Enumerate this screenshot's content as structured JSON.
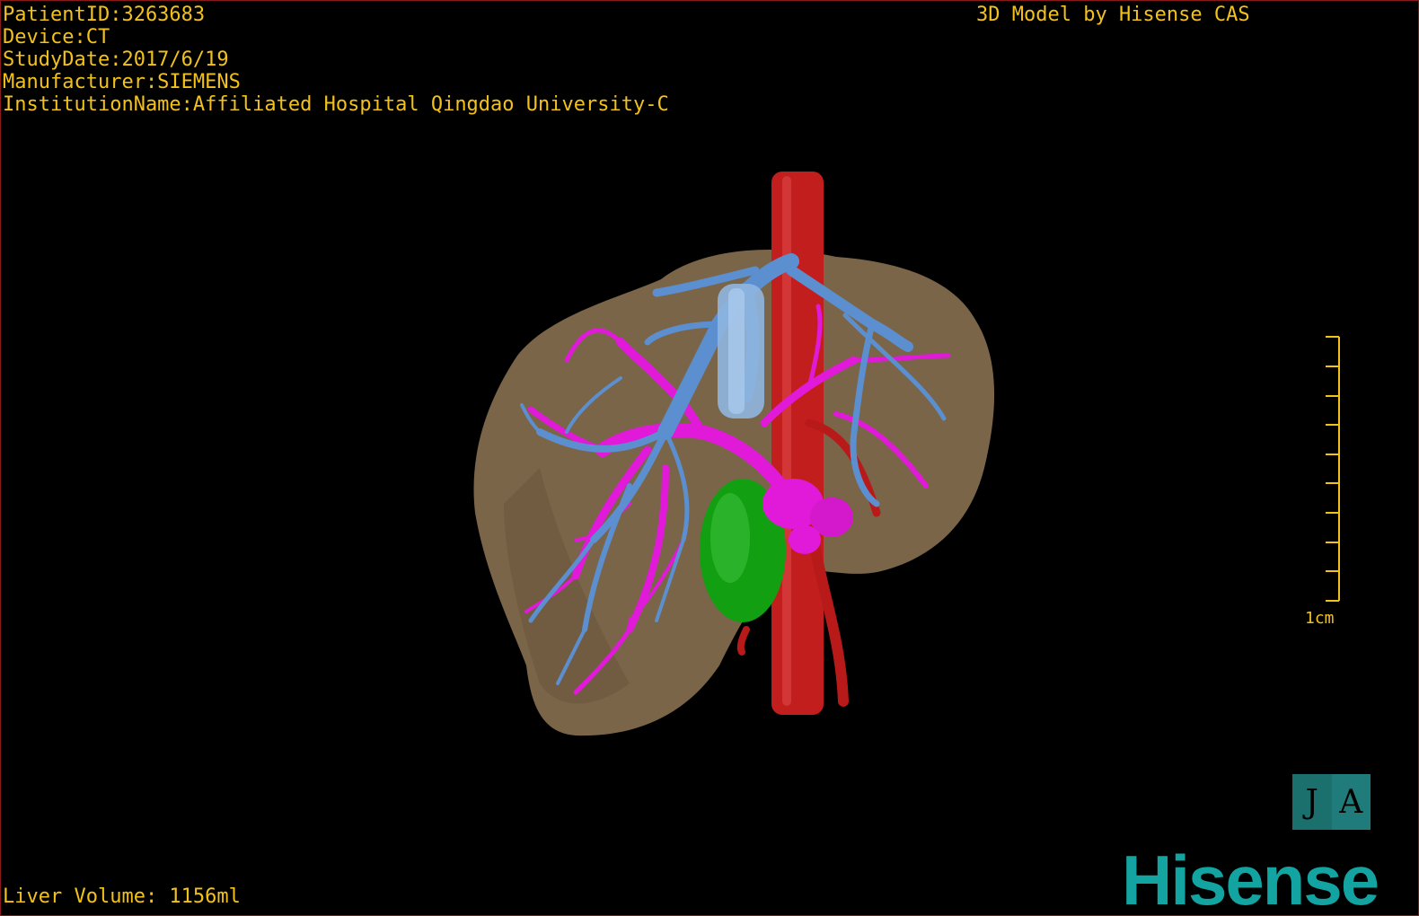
{
  "overlay": {
    "patient_id": "PatientID:3263683",
    "device": "Device:CT",
    "study_date": "StudyDate:2017/6/19",
    "manufacturer": "Manufacturer:SIEMENS",
    "institution": "InstitutionName:Affiliated Hospital Qingdao University-C",
    "credit": "3D Model by Hisense CAS",
    "liver_volume": "Liver Volume: 1156ml"
  },
  "scale_bar": {
    "label": "1cm"
  },
  "orientation_cube": {
    "left_face": "J",
    "right_face": "A"
  },
  "logo": {
    "text": "Hisense"
  },
  "colors": {
    "overlay_text": "#f3c21a",
    "liver": "#7a6548",
    "artery": "#c21e1e",
    "portal_vein": "#e01ad8",
    "hepatic_vein": "#5b8fd0",
    "gallbladder": "#12a012",
    "logo": "#13a3a0"
  }
}
